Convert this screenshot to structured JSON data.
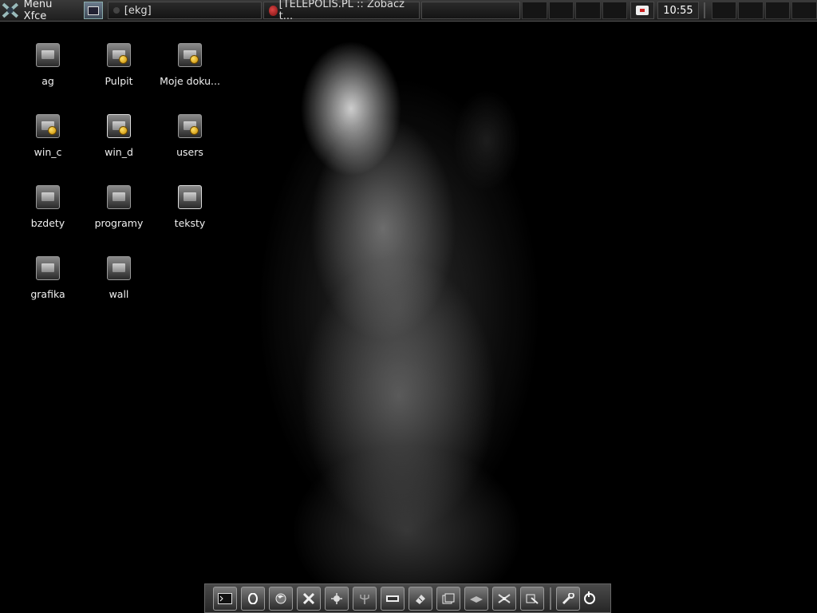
{
  "panel": {
    "menu_label": "Menu Xfce",
    "tasks": [
      {
        "label": "[ekg]"
      },
      {
        "label": "[TELEPOLIS.PL :: Zobacz t..."
      }
    ],
    "clock": "10:55"
  },
  "desktop": {
    "icons": [
      {
        "label": "ag",
        "icon": "folder-icon"
      },
      {
        "label": "Pulpit",
        "icon": "folder-link-icon"
      },
      {
        "label": "Moje doku...",
        "icon": "folder-link-icon"
      },
      {
        "label": "win_c",
        "icon": "folder-link-icon"
      },
      {
        "label": "win_d",
        "icon": "folder-link-icon"
      },
      {
        "label": "users",
        "icon": "folder-link-icon"
      },
      {
        "label": "bzdety",
        "icon": "folder-icon"
      },
      {
        "label": "programy",
        "icon": "folder-icon"
      },
      {
        "label": "teksty",
        "icon": "folder-icon"
      },
      {
        "label": "grafika",
        "icon": "folder-icon"
      },
      {
        "label": "wall",
        "icon": "folder-icon"
      }
    ]
  },
  "dock": {
    "launchers": [
      "terminal-icon",
      "opera-icon",
      "firefox-icon",
      "x-icon",
      "sun-icon",
      "trident-icon",
      "wine-icon",
      "paint-icon",
      "files-icon",
      "mail-icon",
      "satellite-icon",
      "hammer-icon",
      "wrench-icon",
      "power-icon"
    ]
  }
}
